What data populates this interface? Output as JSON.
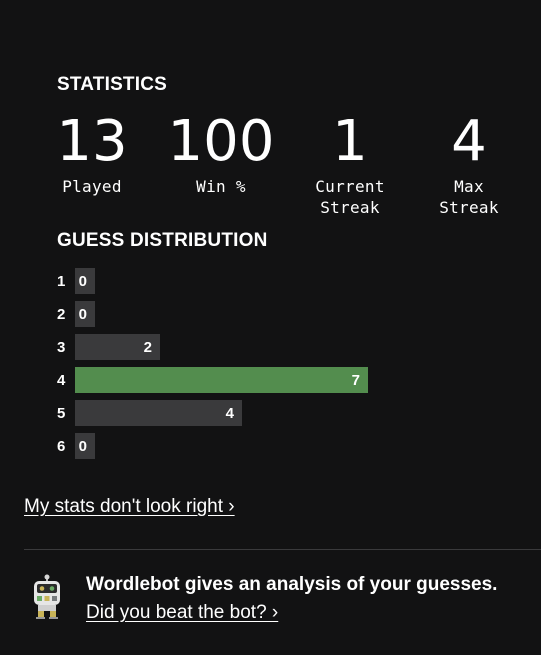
{
  "statistics": {
    "title": "STATISTICS",
    "items": [
      {
        "value": "13",
        "label": "Played"
      },
      {
        "value": "100",
        "label": "Win %"
      },
      {
        "value": "1",
        "label": "Current\nStreak"
      },
      {
        "value": "4",
        "label": "Max\nStreak"
      }
    ]
  },
  "distribution": {
    "title": "GUESS DISTRIBUTION",
    "rows": [
      {
        "guess": "1",
        "count": "0",
        "fraction": 0,
        "highlight": false
      },
      {
        "guess": "2",
        "count": "0",
        "fraction": 0,
        "highlight": false
      },
      {
        "guess": "3",
        "count": "2",
        "fraction": 0.29,
        "highlight": false
      },
      {
        "guess": "4",
        "count": "7",
        "fraction": 1.0,
        "highlight": true
      },
      {
        "guess": "5",
        "count": "4",
        "fraction": 0.57,
        "highlight": false
      },
      {
        "guess": "6",
        "count": "0",
        "fraction": 0,
        "highlight": false
      }
    ]
  },
  "links": {
    "stats_link": "My stats don't look right ›",
    "bot_link": "Did you beat the bot? ›"
  },
  "wordlebot": {
    "text": "Wordlebot gives an analysis of your guesses.",
    "icon": "robot-icon"
  },
  "colors": {
    "background": "#121213",
    "bar": "#3a3a3c",
    "highlight": "#538d4e"
  }
}
